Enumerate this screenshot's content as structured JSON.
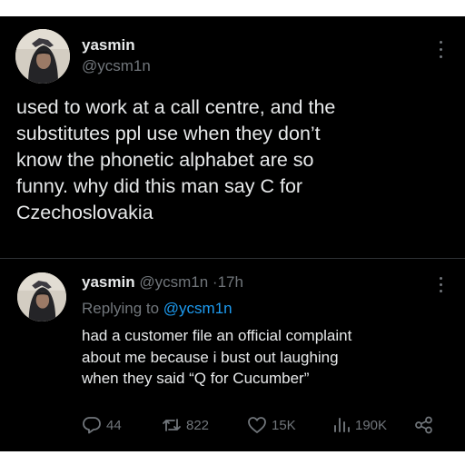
{
  "main_tweet": {
    "display_name": "yasmin",
    "handle": "@ycsm1n",
    "text": "used to work at a call centre, and the\nsubstitutes ppl use when they don’t\nknow the phonetic alphabet are so\nfunny. why did this man say C for\nCzechoslovakia"
  },
  "reply_tweet": {
    "display_name": "yasmin",
    "handle": "@ycsm1n",
    "separator": "·",
    "time": "17h",
    "replying_to_label": "Replying to",
    "replying_to_handle": "@ycsm1n",
    "text": "had a customer file an official complaint\nabout me because i bust out laughing\nwhen they said “Q for Cucumber”"
  },
  "actions": {
    "replies": "44",
    "reposts": "822",
    "likes": "15K",
    "views": "190K"
  },
  "icons": {
    "more": "more-vertical-icon",
    "reply": "reply-bubble-icon",
    "repost": "repost-icon",
    "like": "heart-icon",
    "views": "views-bar-chart-icon",
    "share": "share-icon"
  },
  "colors": {
    "background": "#000000",
    "text": "#e7e9ea",
    "muted": "#71767b",
    "link": "#1d9bf0",
    "divider": "#2f3336"
  }
}
